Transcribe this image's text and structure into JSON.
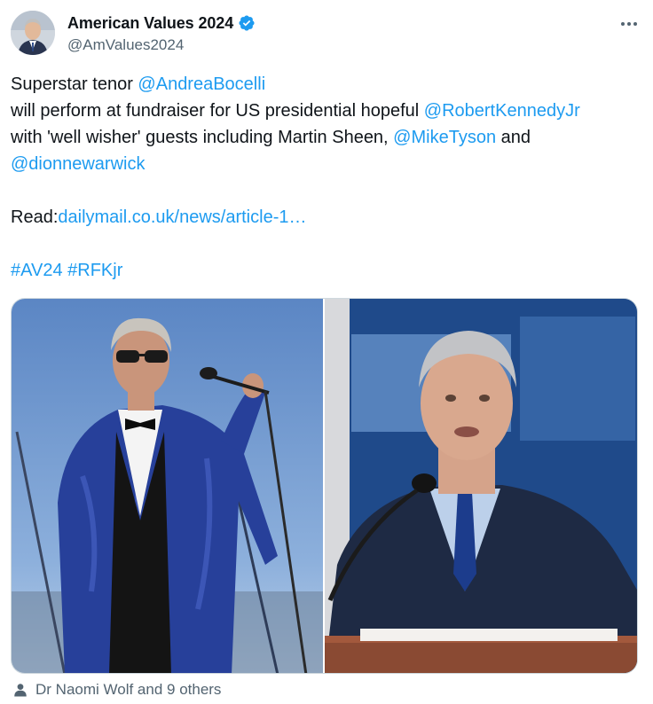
{
  "author": {
    "display_name": "American Values 2024",
    "handle": "@AmValues2024",
    "verified": true
  },
  "tweet": {
    "line1_text": "Superstar tenor ",
    "mention_bocelli": "@AndreaBocelli",
    "line2_text": "will perform at fundraiser for US presidential hopeful ",
    "mention_rfk": "@RobertKennedyJr",
    "line3_text": "with 'well wisher' guests including Martin Sheen, ",
    "mention_tyson": "@MikeTyson",
    "line3_tail": " and",
    "mention_warwick": "@dionnewarwick",
    "read_label": "Read:",
    "link_text": "dailymail.co.uk/news/article-1…",
    "hashtag_1": "#AV24",
    "hashtag_2": "#RFKjr"
  },
  "media": {
    "photo_count": 2
  },
  "footer": {
    "liked_by_text": "Dr Naomi Wolf and 9 others"
  },
  "colors": {
    "link": "#1d9bf0",
    "verified_badge": "#1d9bf0",
    "secondary_text": "#536471"
  },
  "icons": {
    "verified": "verified-badge-icon",
    "more": "more-dots-icon",
    "person": "person-icon"
  }
}
